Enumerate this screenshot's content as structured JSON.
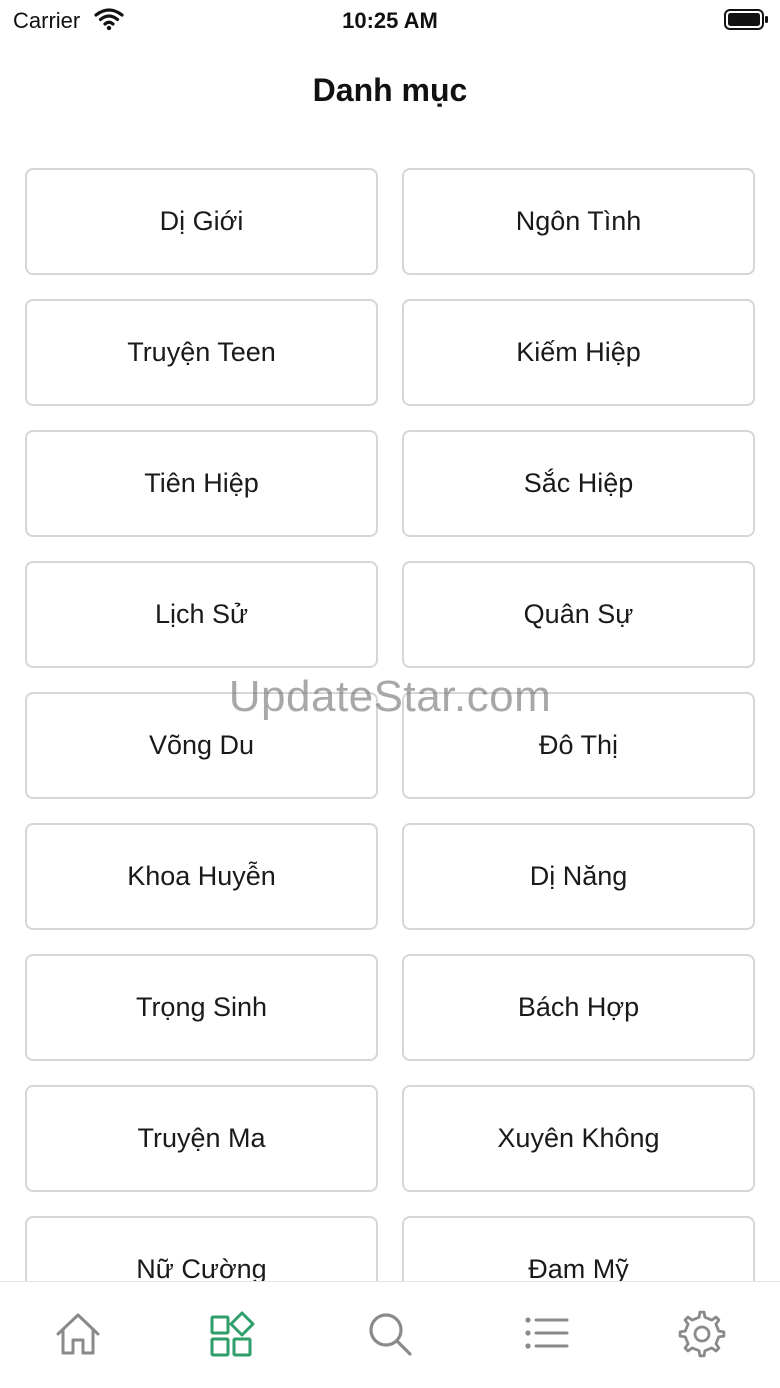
{
  "status_bar": {
    "carrier": "Carrier",
    "time": "10:25 AM"
  },
  "header": {
    "title": "Danh mục"
  },
  "categories": [
    "Dị Giới",
    "Ngôn Tình",
    "Truyện Teen",
    "Kiếm Hiệp",
    "Tiên Hiệp",
    "Sắc Hiệp",
    "Lịch Sử",
    "Quân Sự",
    "Võng Du",
    "Đô Thị",
    "Khoa Huyễn",
    "Dị Năng",
    "Trọng Sinh",
    "Bách Hợp",
    "Truyện Ma",
    "Xuyên Không",
    "Nữ Cường",
    "Đam Mỹ"
  ],
  "watermark": "UpdateStar.com",
  "tab_bar": {
    "tabs": [
      {
        "icon": "home-icon",
        "active": false
      },
      {
        "icon": "categories-icon",
        "active": true
      },
      {
        "icon": "search-icon",
        "active": false
      },
      {
        "icon": "list-icon",
        "active": false
      },
      {
        "icon": "settings-icon",
        "active": false
      }
    ],
    "active_color": "#2e9e6a",
    "inactive_color": "#8a8a8a"
  }
}
